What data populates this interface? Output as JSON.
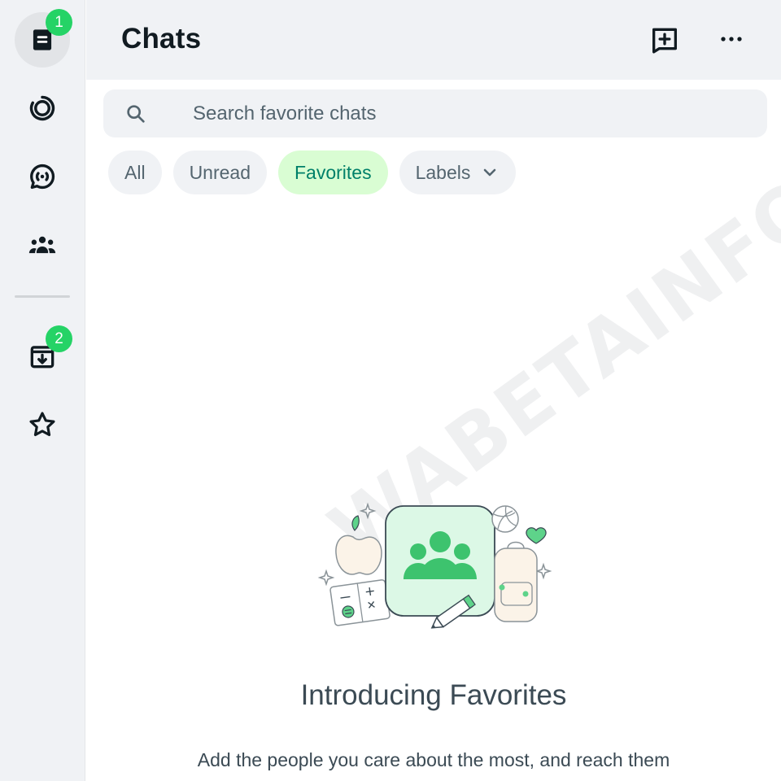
{
  "rail": {
    "items": [
      {
        "name": "chats",
        "icon": "chat-box-icon",
        "badge": "1"
      },
      {
        "name": "status",
        "icon": "status-ring-icon"
      },
      {
        "name": "channels",
        "icon": "channels-icon"
      },
      {
        "name": "communities",
        "icon": "communities-icon"
      },
      {
        "name": "archived",
        "icon": "archive-icon",
        "badge": "2"
      },
      {
        "name": "starred",
        "icon": "star-icon"
      }
    ]
  },
  "header": {
    "title": "Chats",
    "new_chat_icon": "new-chat-icon",
    "menu_icon": "more-menu-icon"
  },
  "search": {
    "placeholder": "Search favorite chats",
    "value": ""
  },
  "filters": [
    {
      "label": "All",
      "selected": false
    },
    {
      "label": "Unread",
      "selected": false
    },
    {
      "label": "Favorites",
      "selected": true
    },
    {
      "label": "Labels",
      "selected": false,
      "dropdown": true
    }
  ],
  "empty_state": {
    "title": "Introducing Favorites",
    "text": "Add the people you care about the most, and reach them"
  },
  "watermark": "WABETAINFO",
  "colors": {
    "accent": "#25d366",
    "chip_selected_bg": "#d9fdd3",
    "chip_selected_text": "#008069",
    "panel_bg": "#f0f2f5"
  }
}
